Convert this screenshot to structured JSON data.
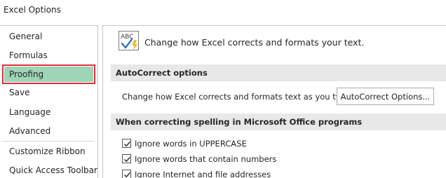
{
  "window": {
    "title": "Excel Options"
  },
  "sidebar": {
    "items": [
      {
        "label": "General",
        "selected": false
      },
      {
        "label": "Formulas",
        "selected": false
      },
      {
        "label": "Proofing",
        "selected": true
      },
      {
        "label": "Save",
        "selected": false
      },
      {
        "label": "Language",
        "selected": false
      },
      {
        "label": "Advanced",
        "selected": false
      },
      {
        "label": "Customize Ribbon",
        "selected": false
      },
      {
        "label": "Quick Access Toolbar",
        "selected": false
      }
    ],
    "highlight_color": "#9fd5b7",
    "selection_border_color": "#e0303e"
  },
  "main": {
    "header": {
      "icon": "abc-check-icon",
      "icon_text": "ABC",
      "text": "Change how Excel corrects and formats your text."
    },
    "autocorrect": {
      "title": "AutoCorrect options",
      "label": "Change how Excel corrects and formats text as you type:",
      "button_label": "AutoCorrect Options..."
    },
    "spelling": {
      "title": "When correcting spelling in Microsoft Office programs",
      "options": [
        {
          "label": "Ignore words in UPPERCASE",
          "checked": true
        },
        {
          "label": "Ignore words that contain numbers",
          "checked": true
        },
        {
          "label": "Ignore Internet and file addresses",
          "checked": true
        }
      ]
    }
  }
}
